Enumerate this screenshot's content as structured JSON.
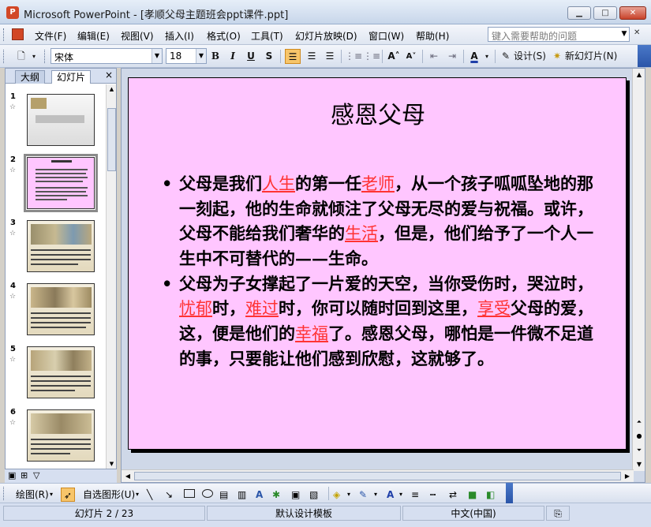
{
  "window": {
    "app_title": "Microsoft PowerPoint - [孝顺父母主题班会ppt课件.ppt]",
    "min_label": "▁",
    "max_label": "□",
    "close_label": "✕"
  },
  "menu": {
    "items": [
      {
        "label": "文件(F)"
      },
      {
        "label": "编辑(E)"
      },
      {
        "label": "视图(V)"
      },
      {
        "label": "插入(I)"
      },
      {
        "label": "格式(O)"
      },
      {
        "label": "工具(T)"
      },
      {
        "label": "幻灯片放映(D)"
      },
      {
        "label": "窗口(W)"
      },
      {
        "label": "帮助(H)"
      }
    ],
    "help_placeholder": "键入需要帮助的问题"
  },
  "format_toolbar": {
    "font_name": "宋体",
    "font_size": "18",
    "bold": "B",
    "italic": "I",
    "underline": "U",
    "shadow": "S",
    "design_label": "设计(S)",
    "new_slide_label": "新幻灯片(N)"
  },
  "left_pane": {
    "tabs": [
      {
        "label": "大纲"
      },
      {
        "label": "幻灯片"
      }
    ],
    "close": "×",
    "thumbnails": [
      {
        "number": "1"
      },
      {
        "number": "2"
      },
      {
        "number": "3"
      },
      {
        "number": "4"
      },
      {
        "number": "5"
      },
      {
        "number": "6"
      }
    ]
  },
  "slide": {
    "title": "感恩父母",
    "bullet_char": "•",
    "bullet1": {
      "t1": "父母是我们",
      "h1": "人生",
      "t2": "的第一任",
      "h2": "老师",
      "t3": "，从一个孩子呱呱坠地的那一刻起，他的生命就倾注了父母无尽的爱与祝福。或许，父母不能给我们奢华的",
      "h3": "生活",
      "t4": "，但是，他们给予了一个人一生中不可替代的——生命。"
    },
    "bullet2": {
      "t1": "父母为子女撑起了一片爱的天空，当你受伤时，哭泣时，",
      "h1": "忧郁",
      "t2": "时，",
      "h2": "难过",
      "t3": "时，你可以随时回到这里，",
      "h3": "享受",
      "t4": "父母的爱，这，便是他们的",
      "h4": "幸福",
      "t5": "了。感恩父母，哪怕是一件微不足道的事，只要能让他们感到欣慰，这就够了。"
    }
  },
  "draw_toolbar": {
    "draw_label": "绘图(R)",
    "autoshapes_label": "自选图形(U)"
  },
  "status": {
    "slide_info": "幻灯片 2 / 23",
    "template": "默认设计模板",
    "language": "中文(中国)"
  },
  "colors": {
    "slide_bg": "#ffc6ff",
    "highlight": "#ff3333",
    "accent_blue": "#2a55a8"
  }
}
